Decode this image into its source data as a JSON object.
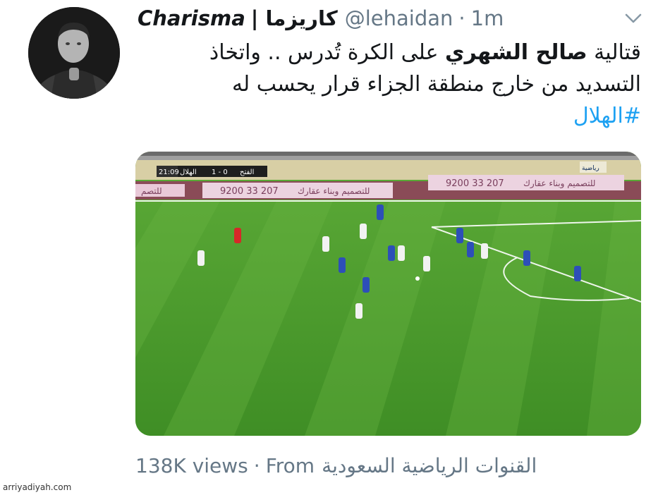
{
  "tweet": {
    "display_name": "Charisma",
    "display_name_ar": "| كاريزما",
    "handle": "@lehaidan",
    "separator": "·",
    "time": "1m",
    "text_line1_a": "قتالية ",
    "text_line1_bold": "صالح الشهري",
    "text_line1_b": " على الكرة تُدرس .. واتخاذ",
    "text_line2": "التسديد من خارج منطقة الجزاء قرار يحسب له",
    "hashtag": "#الهلال"
  },
  "media": {
    "scoreboard_team1": "الفتح",
    "scoreboard_score": "1 - 0",
    "scoreboard_team2": "الهلال",
    "scoreboard_time": "21:09",
    "broadcaster_badge": "رياضية",
    "ad_phone": "9200 33 207",
    "ad_text": "للتصميم وبناء عقارك",
    "ad_text_partial": "للتصم",
    "pitch_color": "#4d9a2a",
    "home_kit_color": "#2d4fb8",
    "away_kit_color": "#f2f2f2"
  },
  "meta": {
    "views": "138K views",
    "separator": "·",
    "from_label": "From",
    "source": "القنوات الرياضية السعودية"
  },
  "watermark": "arriyadiyah.com"
}
